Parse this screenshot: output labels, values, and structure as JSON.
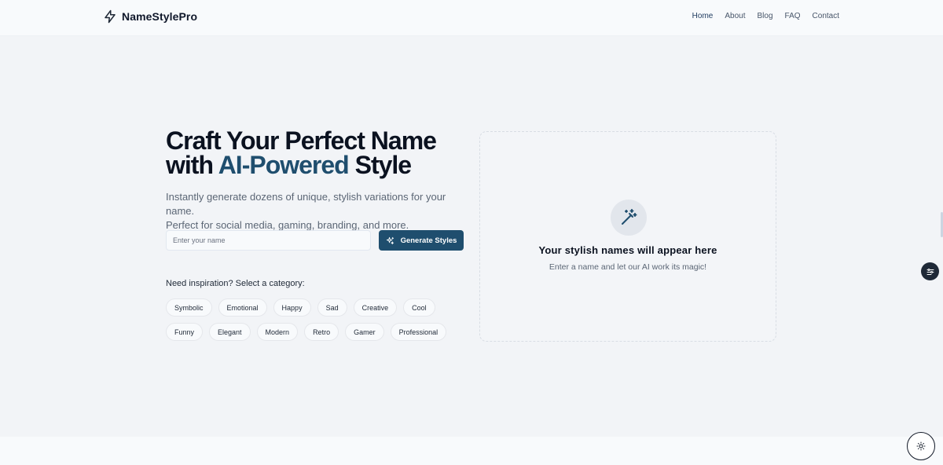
{
  "brand": {
    "name": "NameStylePro",
    "logo_icon": "lightning-bolt-icon"
  },
  "nav": {
    "items": [
      {
        "label": "Home",
        "active": true
      },
      {
        "label": "About",
        "active": false
      },
      {
        "label": "Blog",
        "active": false
      },
      {
        "label": "FAQ",
        "active": false
      },
      {
        "label": "Contact",
        "active": false
      }
    ]
  },
  "hero": {
    "title_line1": "Craft Your Perfect Name",
    "title_with": "with ",
    "title_accent": "AI-Powered",
    "title_end": " Style",
    "subtitle_line1": "Instantly generate dozens of unique, stylish variations for your name.",
    "subtitle_line2": "Perfect for social media, gaming, branding, and more.",
    "input_placeholder": "Enter your name",
    "input_value": "",
    "generate_label": "Generate Styles",
    "generate_icon": "sparkles-icon"
  },
  "categories": {
    "label": "Need inspiration? Select a category:",
    "row1": [
      "Symbolic",
      "Emotional",
      "Happy",
      "Sad",
      "Creative",
      "Cool"
    ],
    "row2": [
      "Funny",
      "Elegant",
      "Modern",
      "Retro",
      "Gamer",
      "Professional"
    ]
  },
  "result_panel": {
    "icon": "magic-wand-icon",
    "title": "Your stylish names will appear here",
    "subtitle": "Enter a name and let our AI work its magic!"
  },
  "colors": {
    "accent": "#1f4e6e",
    "background": "#f2f4f7",
    "header": "#f8fafc",
    "text": "#0f172a"
  }
}
